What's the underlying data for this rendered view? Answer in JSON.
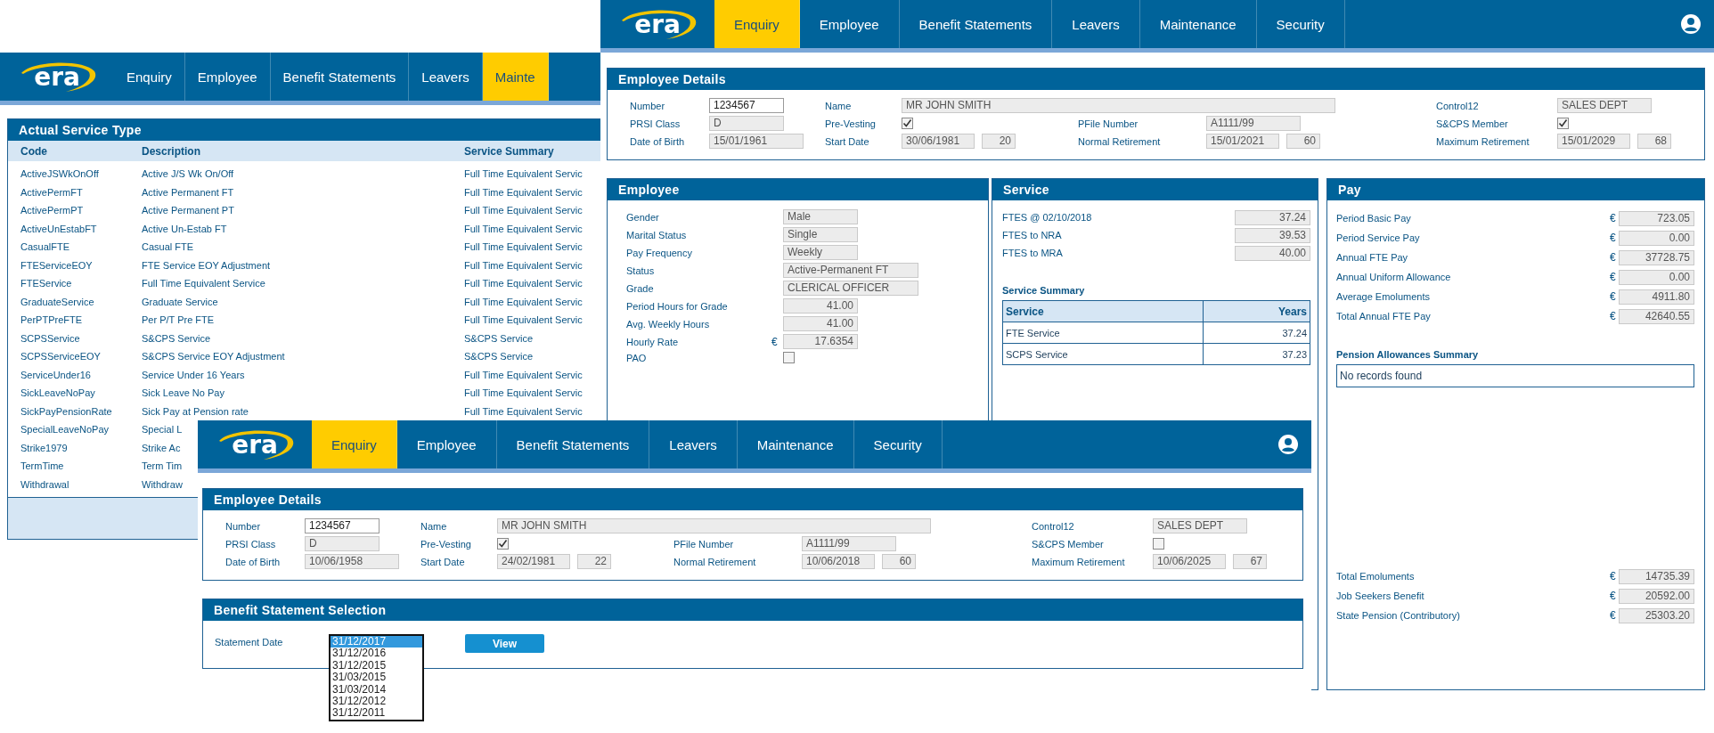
{
  "maintenance_window": {
    "nav": {
      "logo": "era",
      "tabs": [
        {
          "label": "Enquiry",
          "selected": false
        },
        {
          "label": "Employee",
          "selected": false
        },
        {
          "label": "Benefit Statements",
          "selected": false
        },
        {
          "label": "Leavers",
          "selected": false
        },
        {
          "label": "Mainte",
          "selected": true
        }
      ]
    },
    "service_type_table": {
      "title": "Actual Service Type",
      "columns": [
        "Code",
        "Description",
        "Service Summary"
      ],
      "rows": [
        {
          "code": "ActiveJSWkOnOff",
          "description": "Active J/S Wk On/Off",
          "summary": "Full Time Equivalent Servic"
        },
        {
          "code": "ActivePermFT",
          "description": "Active Permanent FT",
          "summary": "Full Time Equivalent Servic"
        },
        {
          "code": "ActivePermPT",
          "description": "Active Permanent PT",
          "summary": "Full Time Equivalent Servic"
        },
        {
          "code": "ActiveUnEstabFT",
          "description": "Active Un-Estab FT",
          "summary": "Full Time Equivalent Servic"
        },
        {
          "code": "CasualFTE",
          "description": "Casual FTE",
          "summary": "Full Time Equivalent Servic"
        },
        {
          "code": "FTEServiceEOY",
          "description": "FTE Service EOY Adjustment",
          "summary": "Full Time Equivalent Servic"
        },
        {
          "code": "FTEService",
          "description": "Full Time Equivalent Service",
          "summary": "Full Time Equivalent Servic"
        },
        {
          "code": "GraduateService",
          "description": "Graduate Service",
          "summary": "Full Time Equivalent Servic"
        },
        {
          "code": "PerPTPreFTE",
          "description": "Per P/T Pre FTE",
          "summary": "Full Time Equivalent Servic"
        },
        {
          "code": "SCPSService",
          "description": "S&CPS Service",
          "summary": "S&CPS Service"
        },
        {
          "code": "SCPSServiceEOY",
          "description": "S&CPS Service EOY Adjustment",
          "summary": "S&CPS Service"
        },
        {
          "code": "ServiceUnder16",
          "description": "Service Under 16 Years",
          "summary": "Full Time Equivalent Servic"
        },
        {
          "code": "SickLeaveNoPay",
          "description": "Sick Leave No Pay",
          "summary": "Full Time Equivalent Servic"
        },
        {
          "code": "SickPayPensionRate",
          "description": "Sick Pay at Pension rate",
          "summary": "Full Time Equivalent Servic"
        },
        {
          "code": "SpecialLeaveNoPay",
          "description": "Special L"
        },
        {
          "code": "Strike1979",
          "description": "Strike Ac"
        },
        {
          "code": "TermTime",
          "description": "Term Tim"
        },
        {
          "code": "Withdrawal",
          "description": "Withdraw"
        }
      ]
    }
  },
  "employee_window": {
    "nav": {
      "logo": "era",
      "tabs": [
        {
          "label": "Enquiry",
          "selected": true
        },
        {
          "label": "Employee",
          "selected": false
        },
        {
          "label": "Benefit Statements",
          "selected": false
        },
        {
          "label": "Leavers",
          "selected": false
        },
        {
          "label": "Maintenance",
          "selected": false
        },
        {
          "label": "Security",
          "selected": false
        }
      ]
    },
    "employee_details": {
      "title": "Employee Details",
      "fields": [
        {
          "label": "Number",
          "kind": "input",
          "value": "1234567"
        },
        {
          "label": "Name",
          "kind": "wide",
          "value": "MR JOHN SMITH"
        },
        {
          "label": "Control12",
          "kind": "readonly",
          "value": "SALES DEPT"
        },
        {
          "label": "PRSI Class",
          "kind": "readonly",
          "value": "D"
        },
        {
          "label": "Pre-Vesting",
          "kind": "check",
          "checked": true
        },
        {
          "label": "PFile Number",
          "kind": "readonly",
          "value": "A1111/99"
        },
        {
          "label": "S&CPS Member",
          "kind": "check",
          "checked": true
        },
        {
          "label": "Date of Birth",
          "kind": "readonly",
          "value": "15/01/1961"
        },
        {
          "label": "Start Date",
          "kind": "pair",
          "value": "30/06/1981",
          "years": "20"
        },
        {
          "label": "Normal Retirement",
          "kind": "pair",
          "value": "15/01/2021",
          "years": "60"
        },
        {
          "label": "Maximum Retirement",
          "kind": "pair",
          "value": "15/01/2029",
          "years": "68"
        }
      ]
    },
    "employee_panel": {
      "title": "Employee",
      "fields": [
        {
          "label": "Gender",
          "kind": "text",
          "value": "Male"
        },
        {
          "label": "Marital Status",
          "kind": "text",
          "value": "Single"
        },
        {
          "label": "Pay Frequency",
          "kind": "text",
          "value": "Weekly"
        },
        {
          "label": "Status",
          "kind": "wide",
          "value": "Active-Permanent FT"
        },
        {
          "label": "Grade",
          "kind": "wide",
          "value": "CLERICAL OFFICER"
        },
        {
          "label": "Period Hours for Grade",
          "kind": "number",
          "value": "41.00"
        },
        {
          "label": "Avg. Weekly Hours",
          "kind": "number",
          "value": "41.00"
        },
        {
          "label": "Hourly Rate",
          "kind": "currency",
          "currency": "€",
          "value": "17.6354"
        },
        {
          "label": "PAO",
          "kind": "check",
          "checked": false
        }
      ]
    },
    "service_panel": {
      "title": "Service",
      "items": [
        {
          "label": "FTES @ 02/10/2018",
          "value": "37.24"
        },
        {
          "label": "FTES to NRA",
          "value": "39.53"
        },
        {
          "label": "FTES to MRA",
          "value": "40.00"
        }
      ],
      "summary": {
        "title": "Service Summary",
        "columns": [
          "Service",
          "Years"
        ],
        "rows": [
          {
            "service": "FTE Service",
            "years": "37.24"
          },
          {
            "service": "SCPS Service",
            "years": "37.23"
          }
        ]
      }
    },
    "pay_panel": {
      "title": "Pay",
      "items": [
        {
          "label": "Period Basic Pay",
          "currency": "€",
          "value": "723.05"
        },
        {
          "label": "Period Service Pay",
          "currency": "€",
          "value": "0.00"
        },
        {
          "label": "Annual FTE Pay",
          "currency": "€",
          "value": "37728.75"
        },
        {
          "label": "Annual Uniform Allowance",
          "currency": "€",
          "value": "0.00"
        },
        {
          "label": "Average Emoluments",
          "currency": "€",
          "value": "4911.80"
        },
        {
          "label": "Total Annual FTE Pay",
          "currency": "€",
          "value": "42640.55"
        }
      ],
      "pension_allowances": {
        "title": "Pension Allowances Summary",
        "message": "No records found"
      },
      "totals": [
        {
          "label": "Total Emoluments",
          "currency": "€",
          "value": "14735.39"
        },
        {
          "label": "Job Seekers Benefit",
          "currency": "€",
          "value": "20592.00"
        },
        {
          "label": "State Pension (Contributory)",
          "currency": "€",
          "value": "25303.20"
        }
      ]
    }
  },
  "statement_window": {
    "nav": {
      "logo": "era",
      "tabs": [
        {
          "label": "Enquiry",
          "selected": true
        },
        {
          "label": "Employee",
          "selected": false
        },
        {
          "label": "Benefit Statements",
          "selected": false
        },
        {
          "label": "Leavers",
          "selected": false
        },
        {
          "label": "Maintenance",
          "selected": false
        },
        {
          "label": "Security",
          "selected": false
        }
      ]
    },
    "employee_details": {
      "title": "Employee Details",
      "fields": [
        {
          "label": "Number",
          "kind": "input",
          "value": "1234567"
        },
        {
          "label": "Name",
          "kind": "wide",
          "value": "MR JOHN SMITH"
        },
        {
          "label": "Control12",
          "kind": "readonly",
          "value": "SALES DEPT"
        },
        {
          "label": "PRSI Class",
          "kind": "readonly",
          "value": "D"
        },
        {
          "label": "Pre-Vesting",
          "kind": "check",
          "checked": true
        },
        {
          "label": "PFile Number",
          "kind": "readonly",
          "value": "A1111/99"
        },
        {
          "label": "S&CPS Member",
          "kind": "check",
          "checked": false
        },
        {
          "label": "Date of Birth",
          "kind": "readonly",
          "value": "10/06/1958"
        },
        {
          "label": "Start Date",
          "kind": "pair",
          "value": "24/02/1981",
          "years": "22"
        },
        {
          "label": "Normal Retirement",
          "kind": "pair",
          "value": "10/06/2018",
          "years": "60"
        },
        {
          "label": "Maximum Retirement",
          "kind": "pair",
          "value": "10/06/2025",
          "years": "67"
        }
      ]
    },
    "benefit_selection": {
      "title": "Benefit Statement Selection",
      "label": "Statement Date",
      "dates": [
        {
          "label": "31/12/2017",
          "selected": true
        },
        {
          "label": "31/12/2016",
          "selected": false
        },
        {
          "label": "31/12/2015",
          "selected": false
        },
        {
          "label": "31/03/2015",
          "selected": false
        },
        {
          "label": "31/03/2014",
          "selected": false
        },
        {
          "label": "31/12/2012",
          "selected": false
        },
        {
          "label": "31/12/2011",
          "selected": false
        }
      ],
      "button": "View"
    }
  }
}
